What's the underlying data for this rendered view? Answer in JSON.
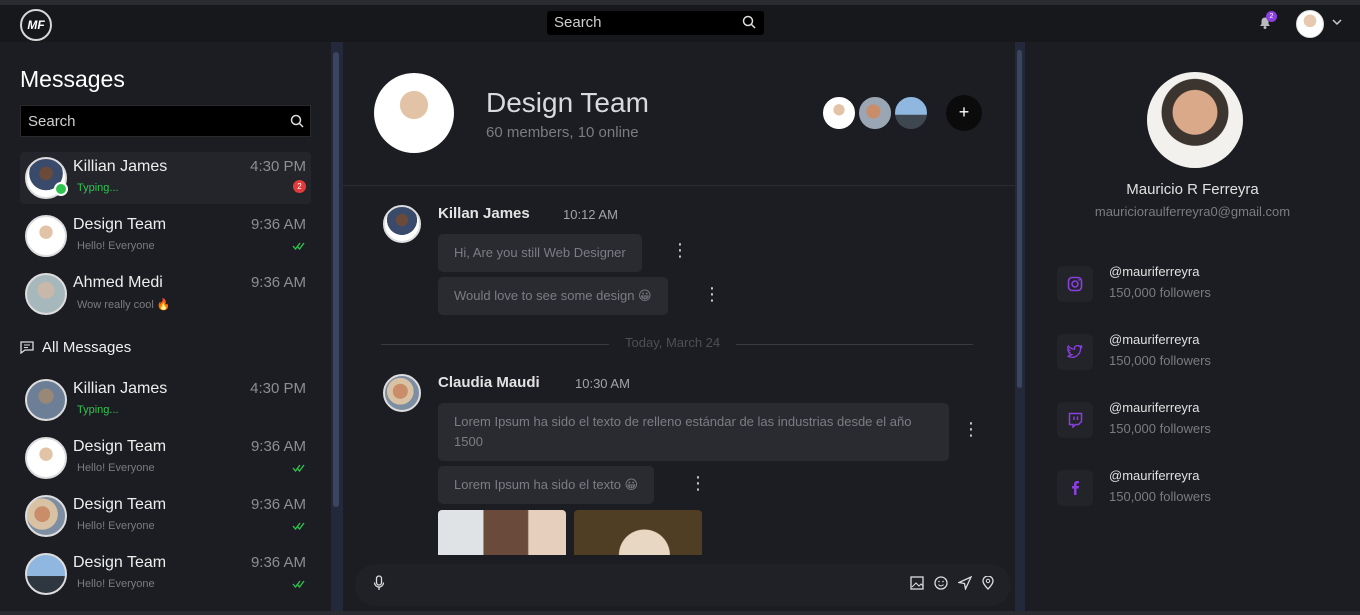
{
  "topbar": {
    "logo": "MF",
    "search_placeholder": "Search",
    "notification_count": "2"
  },
  "sidebar": {
    "title": "Messages",
    "search_placeholder": "Search",
    "recent": [
      {
        "name": "Killian James",
        "time": "4:30 PM",
        "sub": "Typing...",
        "unread": "2"
      },
      {
        "name": "Design Team",
        "time": "9:36 AM",
        "sub": "Hello! Everyone"
      },
      {
        "name": "Ahmed Medi",
        "time": "9:36 AM",
        "sub": "Wow really cool 🔥"
      }
    ],
    "all_label": "All Messages",
    "all": [
      {
        "name": "Killian James",
        "time": "4:30 PM",
        "sub": "Typing..."
      },
      {
        "name": "Design Team",
        "time": "9:36 AM",
        "sub": "Hello! Everyone"
      },
      {
        "name": "Design Team",
        "time": "9:36 AM",
        "sub": "Hello! Everyone"
      },
      {
        "name": "Design Team",
        "time": "9:36 AM",
        "sub": "Hello! Everyone"
      }
    ]
  },
  "chat": {
    "title": "Design Team",
    "subtitle": "60 members, 10 online",
    "add_label": "+",
    "messages": [
      {
        "name": "Killan James",
        "time": "10:12 AM",
        "bubbles": [
          "Hi, Are you still Web Designer",
          "Would love to see some design 😀"
        ]
      },
      {
        "name": "Claudia Maudi",
        "time": "10:30 AM",
        "bubbles": [
          "Lorem Ipsum ha sido el texto de relleno estándar de las industrias desde el año 1500",
          "Lorem Ipsum ha sido el texto 😀"
        ]
      }
    ],
    "divider": "Today, March 24"
  },
  "profile": {
    "name": "Mauricio R Ferreyra",
    "email": "mauricioraulferreyra0@gmail.com",
    "socials": [
      {
        "icon": "instagram-icon",
        "handle": "@mauriferreyra",
        "followers": "150,000 followers"
      },
      {
        "icon": "twitter-icon",
        "handle": "@mauriferreyra",
        "followers": "150,000 followers"
      },
      {
        "icon": "twitch-icon",
        "handle": "@mauriferreyra",
        "followers": "150,000 followers"
      },
      {
        "icon": "facebook-icon",
        "handle": "@mauriferreyra",
        "followers": "150,000 followers"
      }
    ]
  },
  "colors": {
    "accent": "#8b3fe0",
    "online": "#2ec44f",
    "unread": "#e23b3b"
  }
}
